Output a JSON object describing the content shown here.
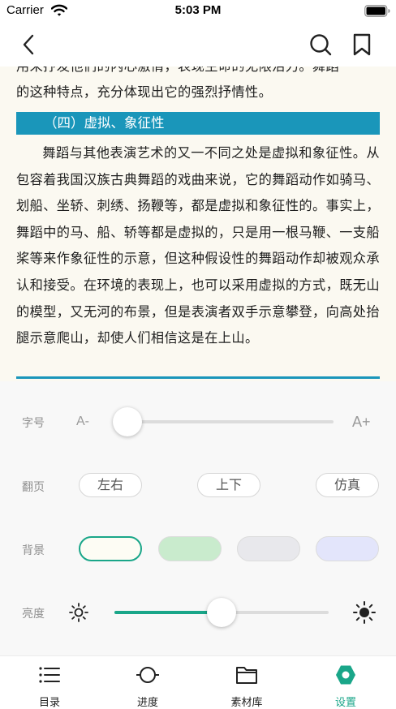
{
  "status_bar": {
    "carrier": "Carrier",
    "time": "5:03 PM"
  },
  "content": {
    "cut_line": "用来抒发他们的内心激情，表现生命的无限活力。舞蹈",
    "prev_line": "的这种特点，充分体现出它的强烈抒情性。",
    "section_title": "（四）虚拟、象征性",
    "paragraph": "舞蹈与其他表演艺术的又一不同之处是虚拟和象征性。从包容着我国汉族古典舞蹈的戏曲来说，它的舞蹈动作如骑马、划船、坐轿、刺绣、扬鞭等，都是虚拟和象征性的。事实上，舞蹈中的马、船、轿等都是虚拟的，只是用一根马鞭、一支船桨等来作象征性的示意，但这种假设性的舞蹈动作却被观众承认和接受。在环境的表现上，也可以采用虚拟的方式，既无山的模型，又无河的布景，但是表演者双手示意攀登，向高处抬腿示意爬山，却使人们相信这是在上山。"
  },
  "settings": {
    "font_size": {
      "label": "字号",
      "small": "A-",
      "large": "A+",
      "level": 0.0
    },
    "page_turn": {
      "label": "翻页",
      "options": [
        "左右",
        "上下",
        "仿真"
      ]
    },
    "background": {
      "label": "背景",
      "swatches": [
        "#fdfcf4",
        "#c9ebcd",
        "#e8e8ec",
        "#e3e5fb"
      ],
      "selected_index": 0
    },
    "brightness": {
      "label": "亮度",
      "level": 0.5
    }
  },
  "colors": {
    "accent": "#1aa689",
    "section": "#1a96ba",
    "paper": "#fbf9f1"
  },
  "tab_bar": {
    "tabs": [
      {
        "label": "目录",
        "icon": "list-icon"
      },
      {
        "label": "进度",
        "icon": "progress-icon"
      },
      {
        "label": "素材库",
        "icon": "folder-icon"
      },
      {
        "label": "设置",
        "icon": "settings-icon"
      }
    ],
    "active_index": 3
  }
}
